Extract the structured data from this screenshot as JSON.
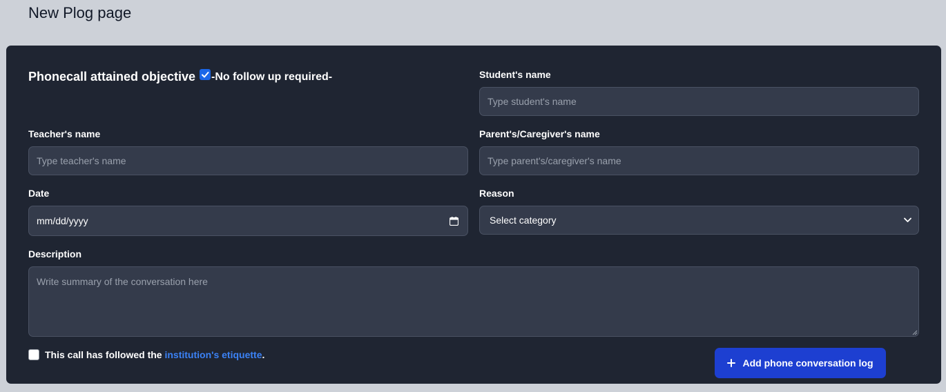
{
  "page": {
    "title": "New Plog page"
  },
  "form": {
    "objective_label": "Phonecall attained objective",
    "objective_checked": true,
    "followup_text": "-No follow up required-",
    "student": {
      "label": "Student's name",
      "placeholder": "Type student's name"
    },
    "teacher": {
      "label": "Teacher's name",
      "placeholder": "Type teacher's name"
    },
    "parent": {
      "label": "Parent's/Caregiver's name",
      "placeholder": "Type parent's/caregiver's name"
    },
    "date": {
      "label": "Date",
      "value": "mm/dd/yyyy"
    },
    "reason": {
      "label": "Reason",
      "selected": "Select category"
    },
    "description": {
      "label": "Description",
      "placeholder": "Write summary of the conversation here"
    },
    "etiquette": {
      "checked": false,
      "prefix": "This call has followed the ",
      "link": "institution's etiquette",
      "suffix": "."
    },
    "submit_label": "Add phone conversation log"
  },
  "colors": {
    "page_bg": "#cdd1d8",
    "panel_bg": "#1f2532",
    "field_bg": "#343b4b",
    "accent": "#1d3fd1",
    "link": "#3b82f6"
  },
  "icons": {
    "date": "calendar-icon",
    "reason": "chevron-down-icon",
    "submit": "plus-icon"
  }
}
